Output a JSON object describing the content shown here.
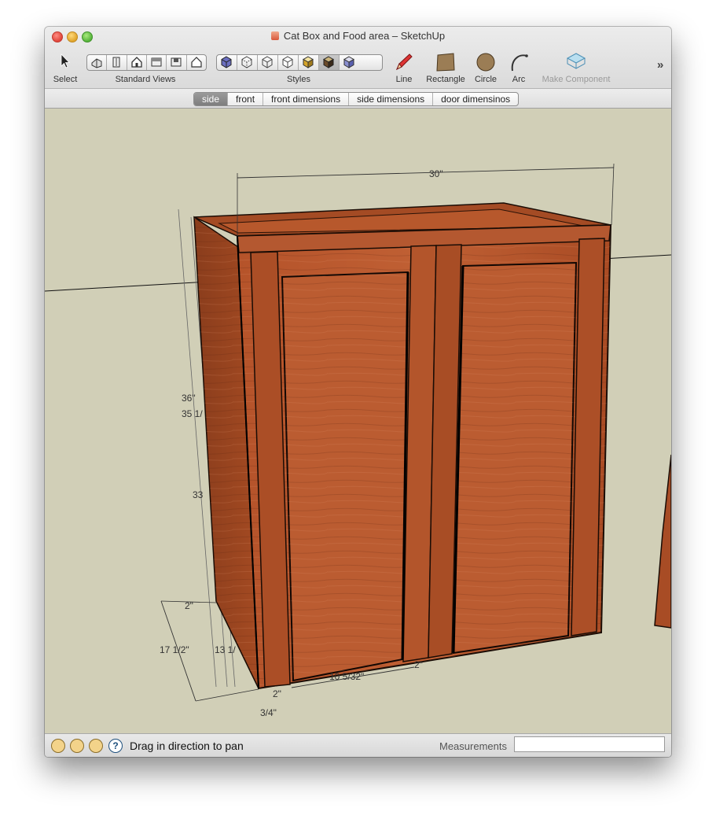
{
  "window": {
    "title": "Cat Box and Food area – SketchUp"
  },
  "toolbar": {
    "select_label": "Select",
    "standard_views_label": "Standard Views",
    "styles_label": "Styles",
    "line_label": "Line",
    "rectangle_label": "Rectangle",
    "circle_label": "Circle",
    "arc_label": "Arc",
    "make_component_label": "Make Component",
    "overflow_label": "»"
  },
  "scenes": [
    {
      "label": "side",
      "active": true
    },
    {
      "label": "front",
      "active": false
    },
    {
      "label": "front dimensions",
      "active": false
    },
    {
      "label": "side dimensions",
      "active": false
    },
    {
      "label": "door dimensinos",
      "active": false
    }
  ],
  "dimensions": {
    "width_top": "30\"",
    "height_outer": "36\"",
    "height_inner": "35 1/",
    "height_mid": "33",
    "depth": "17 1/2\"",
    "depth_inner": "13 1/",
    "rail": "2\"",
    "door_width": "10 5/32\"",
    "stile_right": "2\"",
    "stile_left": "2\"",
    "edge": "3/4\""
  },
  "status": {
    "message": "Drag in direction to pan",
    "measurements_label": "Measurements",
    "measurements_value": ""
  },
  "colors": {
    "viewport_bg": "#d1cfb7",
    "wood": "#b8542a"
  }
}
